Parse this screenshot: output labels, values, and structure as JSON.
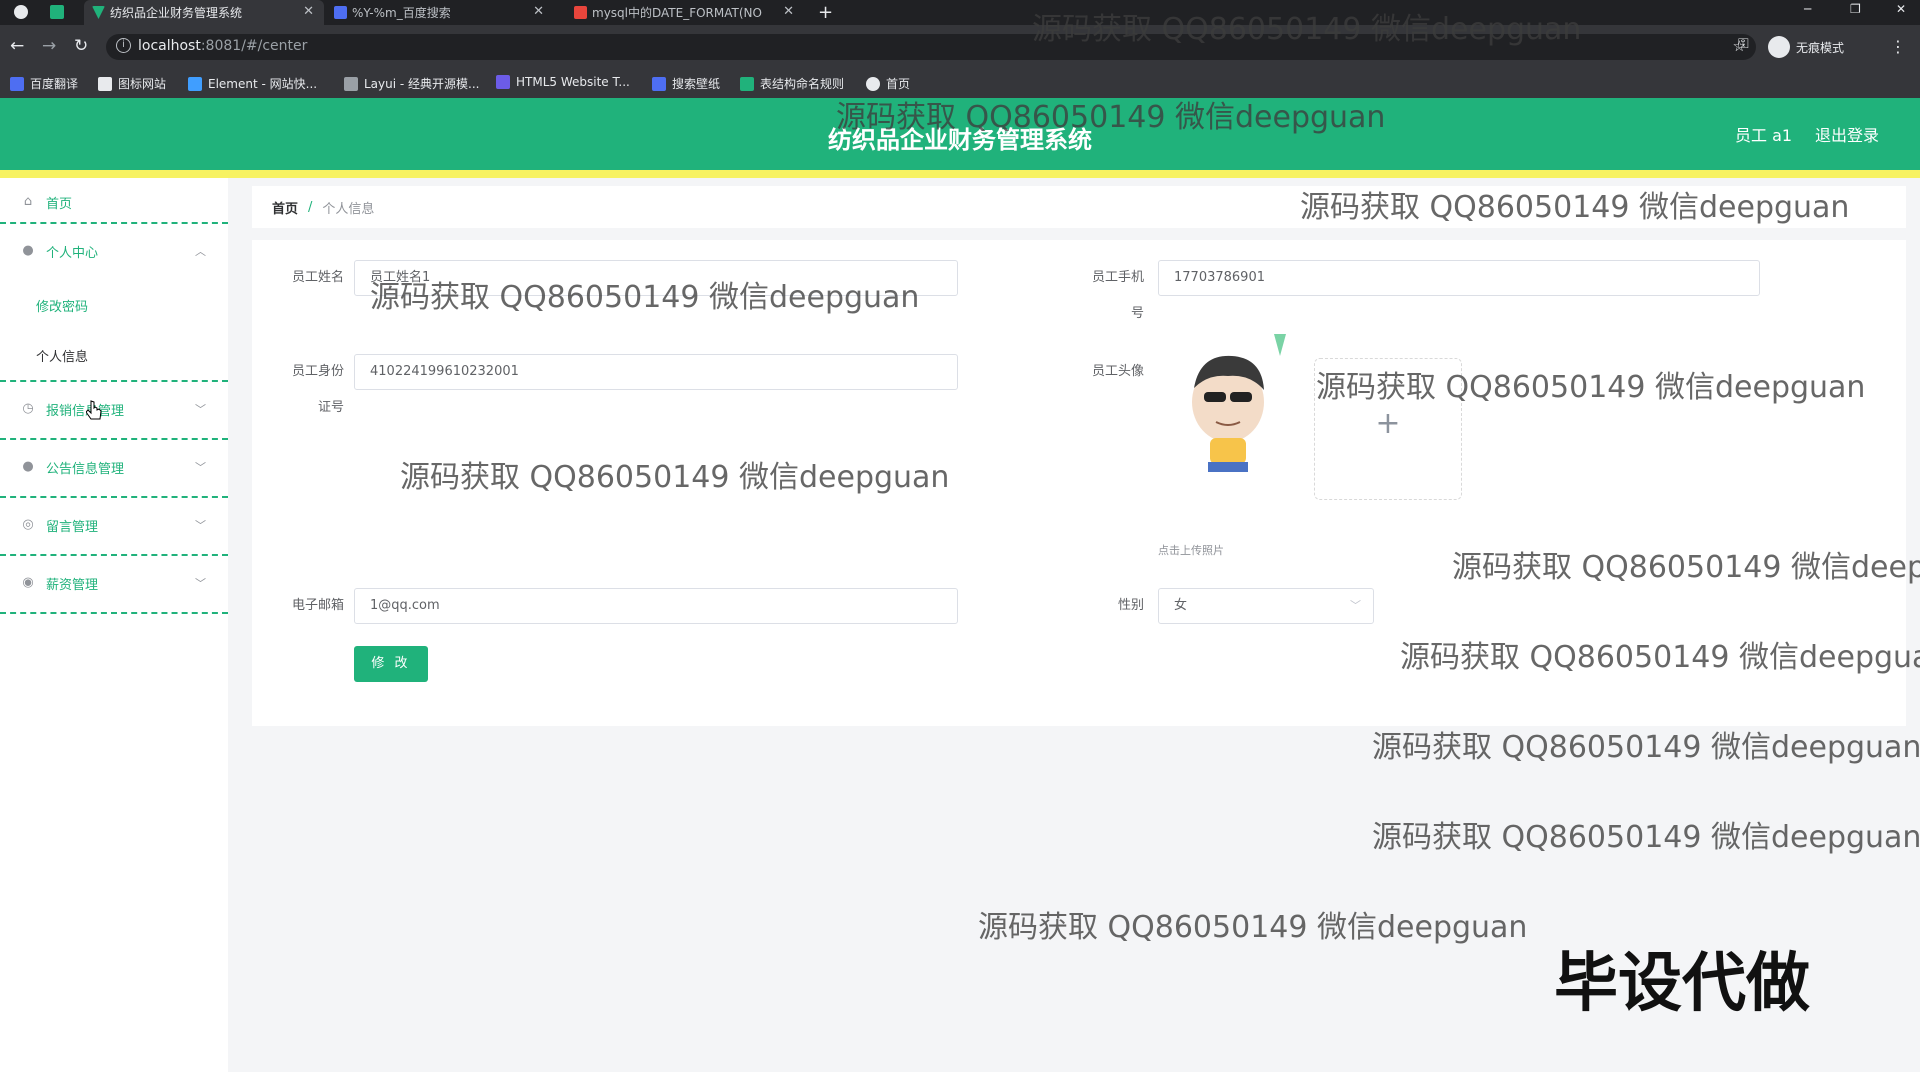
{
  "browser": {
    "tabs": [
      {
        "title": "纺织品企业财务管理系统",
        "color": "#20b27b",
        "icon": "vue-logo-icon"
      },
      {
        "title": "%Y-%m_百度搜索",
        "color": "#4e6ef2",
        "icon": "baidu-paw-icon"
      },
      {
        "title": "mysql中的DATE_FORMAT(NO",
        "color": "#e8453c",
        "icon": "csdn-c-icon"
      }
    ],
    "url_host": "localhost",
    "url_rest": ":8081/#/center",
    "profile_label": "无痕模式",
    "bookmarks": [
      {
        "label": "百度翻译",
        "color": "#4e6ef2"
      },
      {
        "label": "图标网站",
        "color": "#e8eaed"
      },
      {
        "label": "Element - 网站快...",
        "color": "#409eff"
      },
      {
        "label": "Layui - 经典开源模...",
        "color": "#e8eaed"
      },
      {
        "label": "HTML5 Website T...",
        "color": "#6c5ce7"
      },
      {
        "label": "搜索壁纸",
        "color": "#4e6ef2"
      },
      {
        "label": "表结构命名规则",
        "color": "#20b27b"
      },
      {
        "label": "首页",
        "color": "#e8eaed"
      }
    ]
  },
  "header": {
    "title": "纺织品企业财务管理系统",
    "user": "员工 a1",
    "logout": "退出登录",
    "accent": "#20b27b",
    "stripe": "#f7f262"
  },
  "sidebar": {
    "home": "首页",
    "personal": "个人中心",
    "personal_sub": [
      "修改密码",
      "个人信息"
    ],
    "groups": [
      "报销信息管理",
      "公告信息管理",
      "留言管理",
      "薪资管理"
    ]
  },
  "breadcrumb": {
    "home": "首页",
    "separator": "/",
    "current": "个人信息"
  },
  "form": {
    "name_label": "员工姓名",
    "name_value": "员工姓名1",
    "phone_label_1": "员工手机",
    "phone_label_2": "号",
    "phone_value": "17703786901",
    "id_label_1": "员工身份",
    "id_label_2": "证号",
    "id_value": "410224199610232001",
    "avatar_label": "员工头像",
    "upload_plus": "+",
    "upload_tip": "点击上传照片",
    "email_label": "电子邮箱",
    "email_value": "1@qq.com",
    "gender_label": "性别",
    "gender_value": "女",
    "submit": "修 改"
  },
  "watermark": "源码获取 QQ86050149 微信deepguan",
  "promo_text": "毕设代做"
}
